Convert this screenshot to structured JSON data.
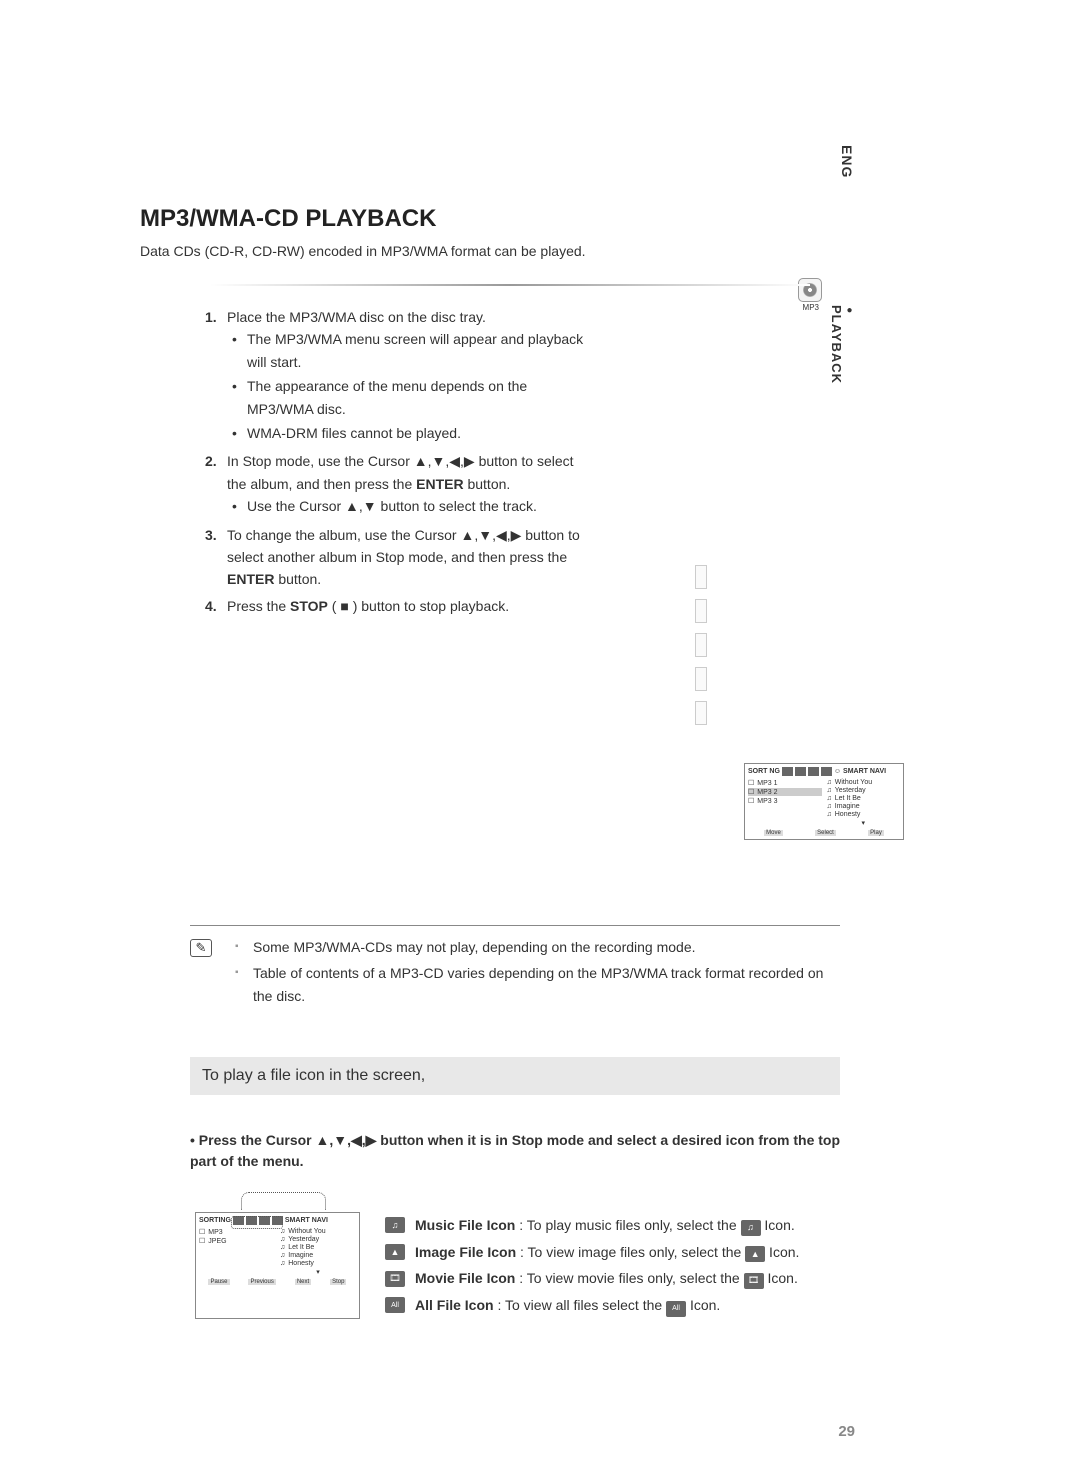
{
  "language_tag": "ENG",
  "section_tab": "PLAYBACK",
  "disc_label": "MP3",
  "title": "MP3/WMA-CD PLAYBACK",
  "subtitle": "Data CDs (CD-R, CD-RW) encoded in MP3/WMA format can be played.",
  "steps": {
    "s1": {
      "num": "1.",
      "text": "Place the MP3/WMA disc on the disc tray.",
      "b1": "The MP3/WMA menu screen will appear and playback will start.",
      "b2": "The appearance of the menu depends on the MP3/WMA disc.",
      "b3": "WMA-DRM files cannot be played."
    },
    "s2": {
      "num": "2.",
      "text_a": "In Stop mode, use the Cursor ▲,▼,◀,▶ button to select the album, and then press the ",
      "enter": "ENTER",
      "text_b": " button.",
      "b1": "Use the Cursor ▲,▼ button to select the track."
    },
    "s3": {
      "num": "3.",
      "text_a": "To change the album, use the Cursor ▲,▼,◀,▶ button to select another album in Stop mode, and then press the ",
      "enter": "ENTER",
      "text_b": " button."
    },
    "s4": {
      "num": "4.",
      "text_a": "Press the ",
      "stop": "STOP",
      "text_b": " ( ■ ) button to stop playback."
    }
  },
  "ui1": {
    "sort": "SORT NG",
    "smart": "SMART NAVI",
    "folders": {
      "f1": "MP3 1",
      "f2": "MP3 2",
      "f3": "MP3 3"
    },
    "tracks": {
      "t1": "Without You",
      "t2": "Yesterday",
      "t3": "Let It Be",
      "t4": "Imagine",
      "t5": "Honesty"
    },
    "footer": {
      "a": "Move",
      "b": "Select",
      "c": "Play"
    }
  },
  "notes": {
    "n1": "Some MP3/WMA-CDs may not play, depending on the recording mode.",
    "n2": "Table of contents of a MP3-CD varies depending on the MP3/WMA track format recorded on the disc."
  },
  "sub_heading": "To play a file icon in the screen,",
  "instruction2": "• Press the Cursor ▲,▼,◀,▶ button when it is in Stop mode and select a desired icon from the top part of the menu.",
  "ui2": {
    "sort": "SORTING",
    "smart": "SMART NAVI",
    "folders": {
      "f1": "MP3",
      "f2": "JPEG"
    },
    "tracks": {
      "t1": "Without You",
      "t2": "Yesterday",
      "t3": "Let It Be",
      "t4": "Imagine",
      "t5": "Honesty"
    },
    "footer": {
      "a": "Pause",
      "b": "Previous",
      "c": "Next",
      "d": "Stop"
    }
  },
  "legend": {
    "music": {
      "glyph": "♫",
      "bold": "Music File Icon",
      "text": " : To play music files only, select the ",
      "tail": " Icon."
    },
    "image": {
      "glyph": "▲",
      "bold": "Image File Icon",
      "text": " : To view image files only, select the ",
      "tail": " Icon."
    },
    "movie": {
      "glyph": "🎞",
      "bold": "Movie File Icon",
      "text": " : To view movie files only, select the ",
      "tail": " Icon."
    },
    "all": {
      "glyph": "All",
      "bold": "All File Icon",
      "text": " : To view all files select the ",
      "tail": " Icon."
    }
  },
  "page_number": "29"
}
